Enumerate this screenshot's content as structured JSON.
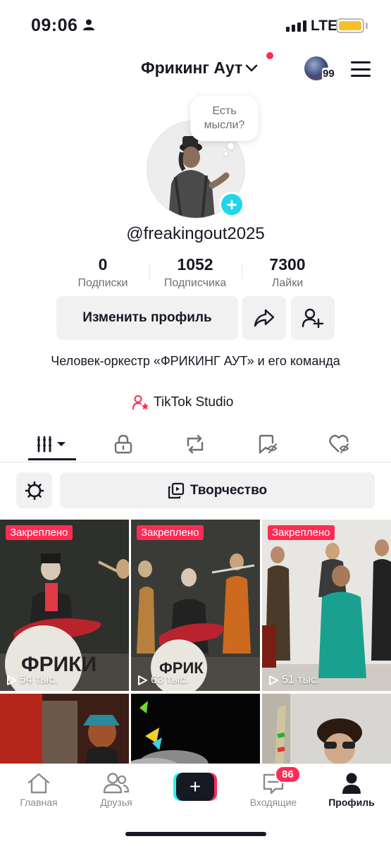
{
  "status_bar": {
    "time": "09:06",
    "network": "LTE"
  },
  "header": {
    "account_name": "Фрикинг Аут",
    "notifications_count": "99"
  },
  "profile": {
    "thought_bubble": "Есть\nмысли?",
    "username": "@freakingout2025",
    "stats": [
      {
        "value": "0",
        "label": "Подписки"
      },
      {
        "value": "1052",
        "label": "Подписчика"
      },
      {
        "value": "7300",
        "label": "Лайки"
      }
    ],
    "edit_button": "Изменить профиль",
    "bio": "Человек-оркестр «ФРИКИНГ АУТ» и его команда",
    "studio_link": "TikTok Studio"
  },
  "tabs": [
    "videos-grid",
    "private",
    "reposts",
    "favorites",
    "liked"
  ],
  "filter": {
    "creativity_label": "Творчество"
  },
  "videos": [
    {
      "pinned": "Закреплено",
      "views": "54 тыс."
    },
    {
      "pinned": "Закреплено",
      "views": "63 тыс."
    },
    {
      "pinned": "Закреплено",
      "views": "51 тыс."
    }
  ],
  "bottom_nav": {
    "home": "Главная",
    "friends": "Друзья",
    "inbox": "Входящие",
    "inbox_badge": "86",
    "profile": "Профиль"
  },
  "colors": {
    "accent": "#fe2c55",
    "cyan": "#25f4ee",
    "plus_badge": "#20d5ec"
  }
}
